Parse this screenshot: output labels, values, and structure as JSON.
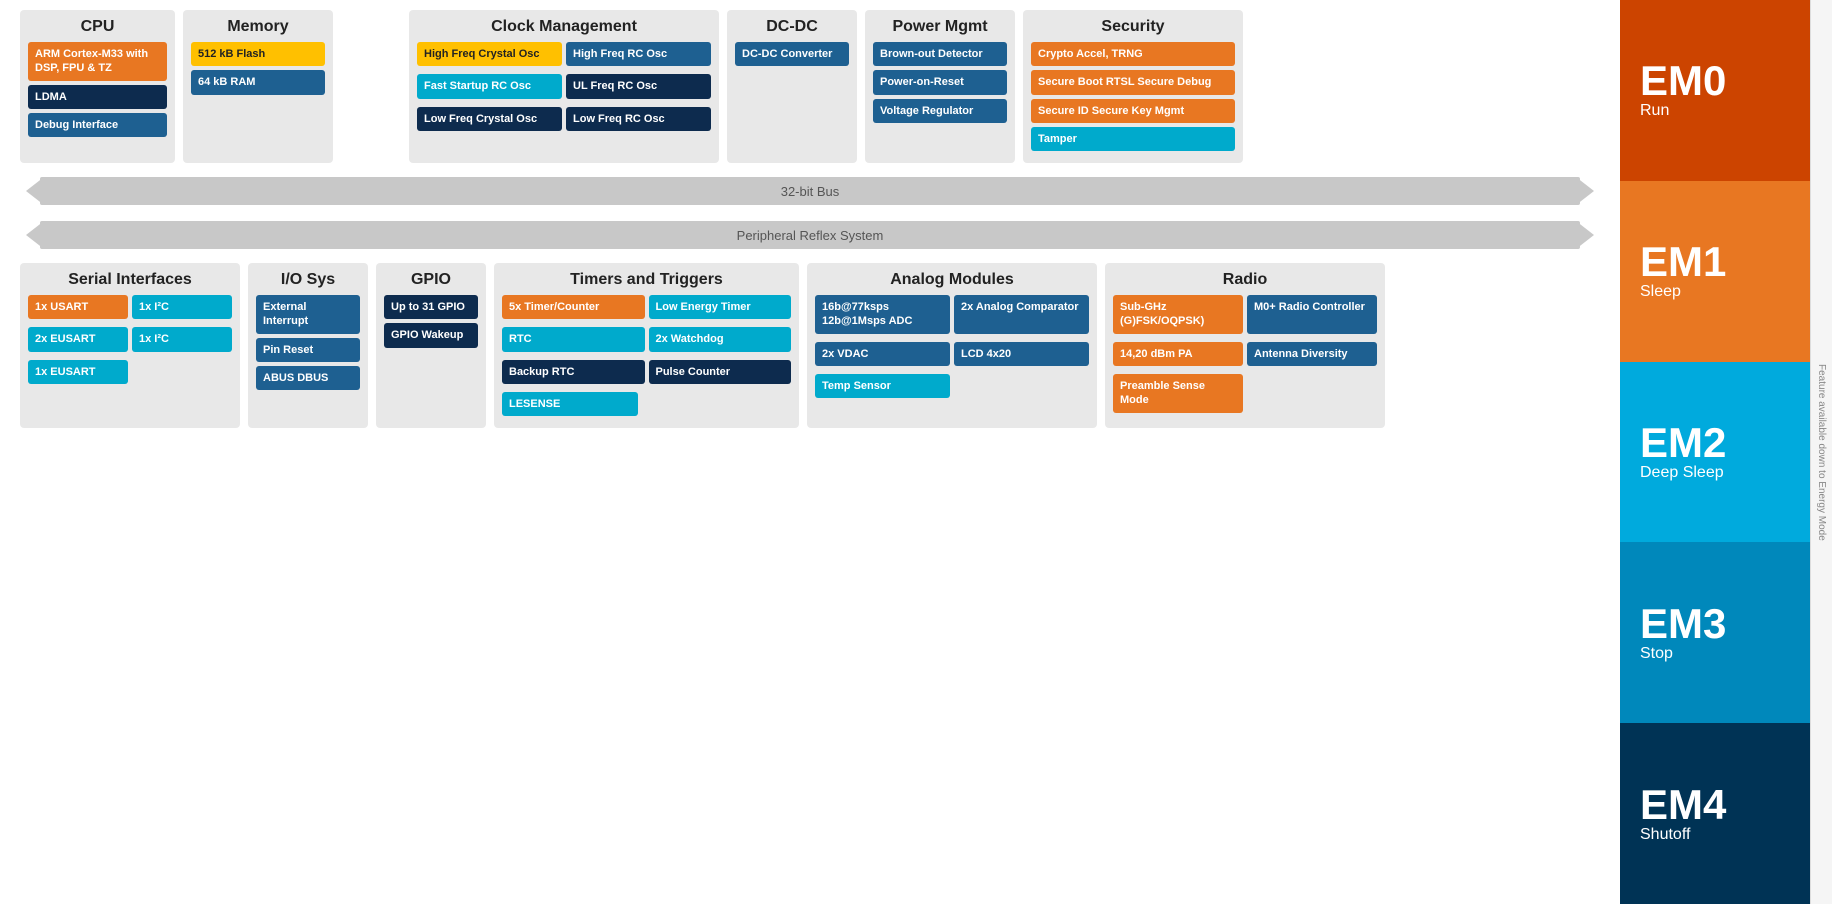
{
  "cpu": {
    "title": "CPU",
    "blocks": [
      {
        "text": "ARM Cortex-M33 with DSP, FPU & TZ",
        "color": "orange"
      },
      {
        "text": "LDMA",
        "color": "dark-navy"
      },
      {
        "text": "Debug Interface",
        "color": "blue-mid"
      }
    ]
  },
  "memory": {
    "title": "Memory",
    "blocks": [
      {
        "text": "512 kB Flash",
        "color": "yellow"
      },
      {
        "text": "64 kB RAM",
        "color": "blue-mid"
      }
    ]
  },
  "clock": {
    "title": "Clock Management",
    "blocks": [
      {
        "text": "High Freq Crystal Osc",
        "color": "yellow"
      },
      {
        "text": "High Freq RC Osc",
        "color": "blue-mid"
      },
      {
        "text": "Fast Startup RC Osc",
        "color": "blue-light"
      },
      {
        "text": "UL Freq RC Osc",
        "color": "dark-navy"
      },
      {
        "text": "Low Freq Crystal Osc",
        "color": "dark-navy"
      },
      {
        "text": "Low Freq RC Osc",
        "color": "dark-navy"
      }
    ]
  },
  "dcdc": {
    "title": "DC-DC",
    "blocks": [
      {
        "text": "DC-DC Converter",
        "color": "blue-mid"
      }
    ]
  },
  "power": {
    "title": "Power Mgmt",
    "blocks": [
      {
        "text": "Brown-out Detector",
        "color": "blue-mid"
      },
      {
        "text": "Power-on-Reset",
        "color": "blue-mid"
      },
      {
        "text": "Voltage Regulator",
        "color": "blue-mid"
      }
    ]
  },
  "security": {
    "title": "Security",
    "blocks": [
      {
        "text": "Crypto Accel, TRNG",
        "color": "orange"
      },
      {
        "text": "Secure Boot RTSL Secure Debug",
        "color": "orange"
      },
      {
        "text": "Secure ID Secure Key Mgmt",
        "color": "orange"
      },
      {
        "text": "Tamper",
        "color": "blue-light"
      }
    ]
  },
  "bus32": {
    "label": "32-bit Bus"
  },
  "busPRS": {
    "label": "Peripheral Reflex System"
  },
  "serial": {
    "title": "Serial Interfaces",
    "blocks": [
      {
        "text": "1x USART",
        "color": "orange"
      },
      {
        "text": "1x I²C",
        "color": "blue-light"
      },
      {
        "text": "2x EUSART",
        "color": "blue-light"
      },
      {
        "text": "1x I²C",
        "color": "blue-light"
      },
      {
        "text": "1x EUSART",
        "color": "blue-light"
      }
    ]
  },
  "ios": {
    "title": "I/O Sys",
    "blocks": [
      {
        "text": "External Interrupt",
        "color": "blue-mid"
      },
      {
        "text": "Pin Reset",
        "color": "blue-mid"
      },
      {
        "text": "ABUS DBUS",
        "color": "blue-mid"
      }
    ]
  },
  "gpio": {
    "title": "GPIO",
    "blocks": [
      {
        "text": "Up to 31 GPIO",
        "color": "dark-navy"
      },
      {
        "text": "GPIO Wakeup",
        "color": "dark-navy"
      }
    ]
  },
  "timers": {
    "title": "Timers and Triggers",
    "blocks": [
      {
        "text": "5x Timer/Counter",
        "color": "orange"
      },
      {
        "text": "Low Energy Timer",
        "color": "blue-light"
      },
      {
        "text": "RTC",
        "color": "blue-light"
      },
      {
        "text": "2x Watchdog",
        "color": "blue-light"
      },
      {
        "text": "Backup RTC",
        "color": "dark-navy"
      },
      {
        "text": "Pulse Counter",
        "color": "dark-navy"
      },
      {
        "text": "LESENSE",
        "color": "blue-light"
      }
    ]
  },
  "analog": {
    "title": "Analog Modules",
    "blocks": [
      {
        "text": "16b@77ksps 12b@1Msps ADC",
        "color": "blue-mid"
      },
      {
        "text": "2x Analog Comparator",
        "color": "blue-mid"
      },
      {
        "text": "2x VDAC",
        "color": "blue-mid"
      },
      {
        "text": "LCD 4x20",
        "color": "blue-mid"
      },
      {
        "text": "Temp Sensor",
        "color": "blue-light"
      }
    ]
  },
  "radio": {
    "title": "Radio",
    "blocks": [
      {
        "text": "Sub-GHz (G)FSK/OQPSK)",
        "color": "orange"
      },
      {
        "text": "M0+ Radio Controller",
        "color": "blue-mid"
      },
      {
        "text": "14,20 dBm PA",
        "color": "orange"
      },
      {
        "text": "Antenna Diversity",
        "color": "blue-mid"
      },
      {
        "text": "Preamble Sense Mode",
        "color": "orange"
      }
    ]
  },
  "sidebar": {
    "feature_label": "Feature available down to Energy Mode",
    "levels": [
      {
        "id": "EM0",
        "label": "Run",
        "color_class": "em0"
      },
      {
        "id": "EM1",
        "label": "Sleep",
        "color_class": "em1"
      },
      {
        "id": "EM2",
        "label": "Deep Sleep",
        "color_class": "em2"
      },
      {
        "id": "EM3",
        "label": "Stop",
        "color_class": "em3"
      },
      {
        "id": "EM4",
        "label": "Shutoff",
        "color_class": "em4"
      }
    ]
  }
}
